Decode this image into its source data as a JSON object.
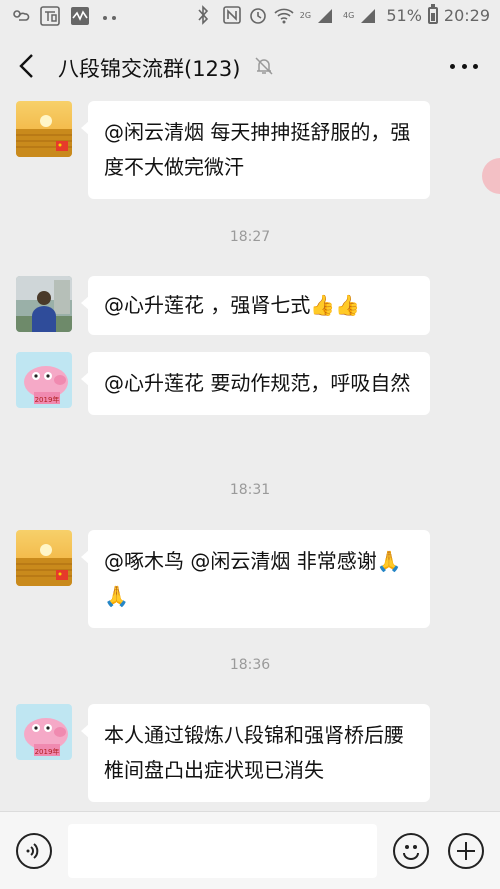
{
  "status_bar": {
    "battery": "51%",
    "time": "20:29",
    "network_a": "2G",
    "network_b": "4G",
    "icons": [
      "weather-icon",
      "store-app-icon",
      "pulse-app-icon",
      "more-dots-icon",
      "bluetooth-icon",
      "nfc-icon",
      "alarm-icon",
      "wifi-icon",
      "signal-icon",
      "battery-icon"
    ]
  },
  "header": {
    "title": "八段锦交流群(123)",
    "icons": [
      "back-arrow-icon",
      "mute-bell-icon",
      "more-dots-icon"
    ]
  },
  "messages": [
    {
      "text": "@闲云清烟  每天抻抻挺舒服的，强度不大做完微汗",
      "avatar": "wheat-field-sunset-avatar"
    },
    {
      "time": "18:27"
    },
    {
      "text": "@心升莲花  ，强肾七式👍👍",
      "avatar": "man-photo-avatar"
    },
    {
      "text": "@心升莲花  要动作规范，呼吸自然",
      "avatar": "peppa-pig-avatar"
    },
    {
      "time": "18:31"
    },
    {
      "text": "@啄木鸟  @闲云清烟  非常感谢🙏🙏",
      "avatar": "wheat-field-sunset-avatar"
    },
    {
      "time": "18:36"
    },
    {
      "text": "本人通过锻炼八段锦和强肾桥后腰椎间盘凸出症状现已消失",
      "avatar": "peppa-pig-avatar"
    }
  ],
  "peppa_badge": "2019年",
  "input": {
    "value": "",
    "placeholder": ""
  },
  "colors": {
    "background": "#ededed",
    "bubble": "#ffffff",
    "timestamp": "#9a9a9a",
    "input_bar": "#f6f6f6"
  }
}
